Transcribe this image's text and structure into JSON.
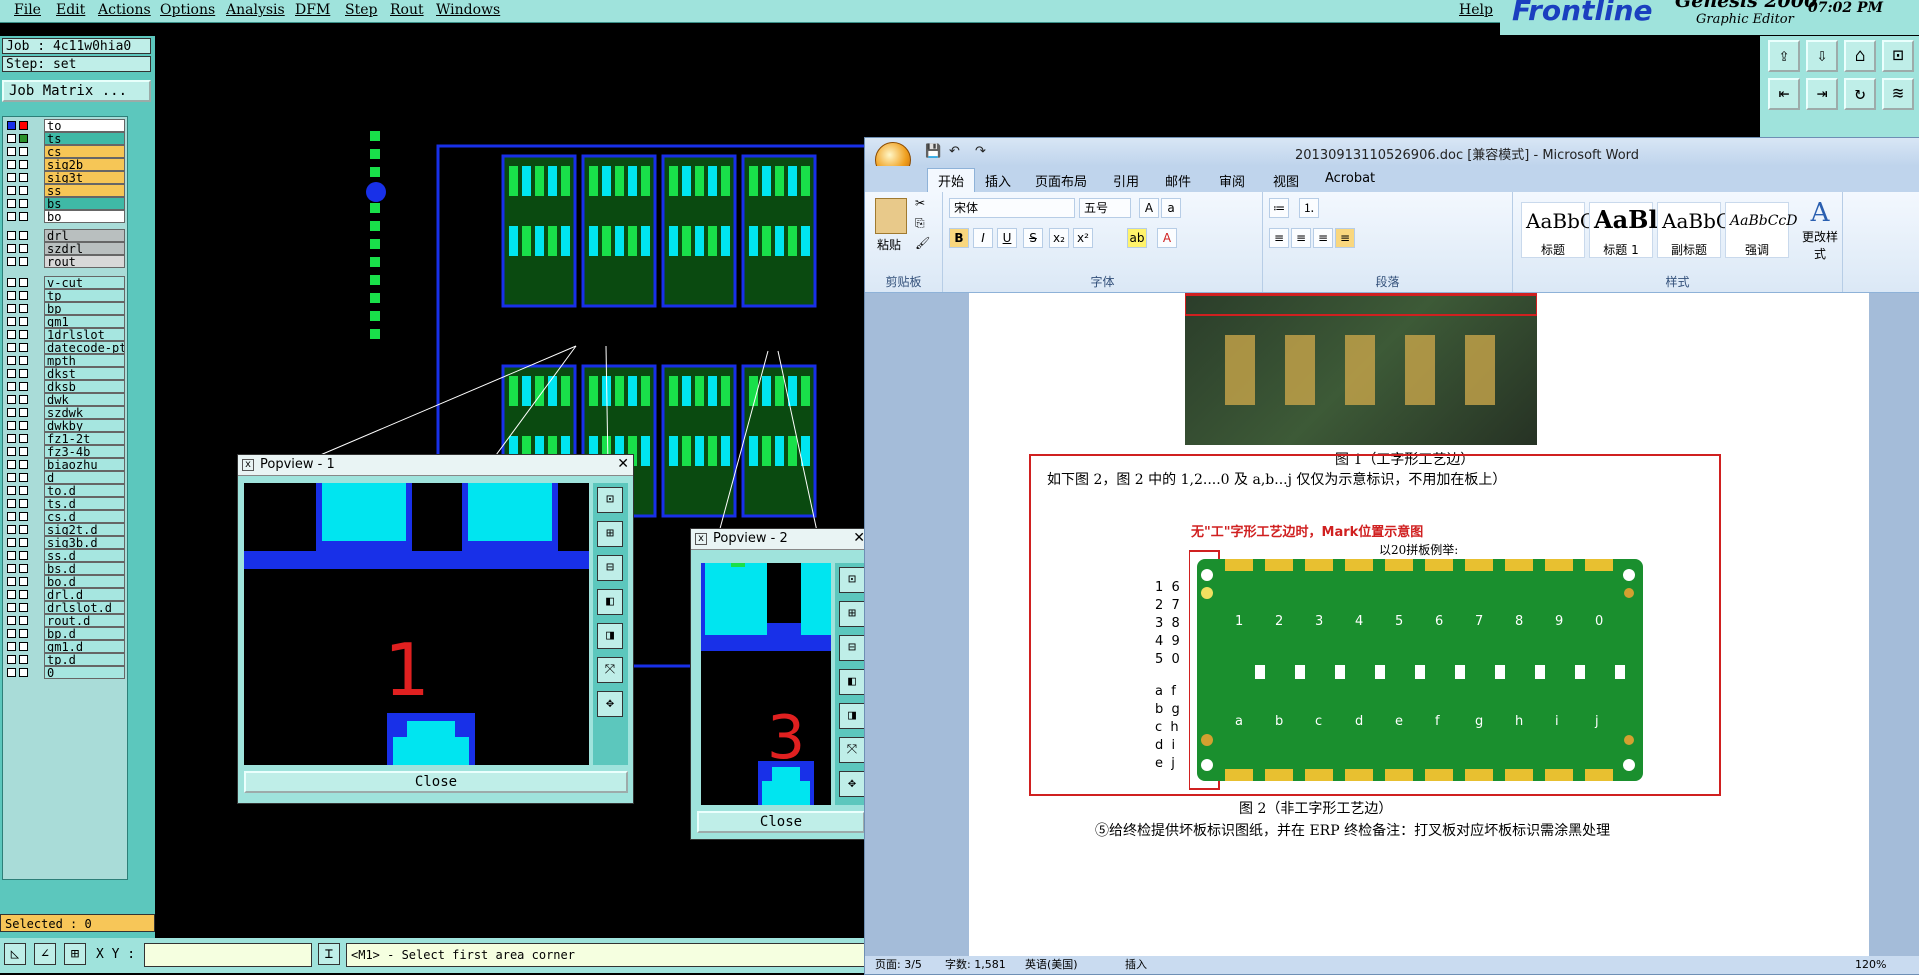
{
  "menubar": {
    "items": [
      "File",
      "Edit",
      "Actions",
      "Options",
      "Analysis",
      "DFM",
      "Step",
      "Rout",
      "Windows"
    ],
    "help": "Help"
  },
  "logo": {
    "brand": "Frontline",
    "product": "Genesis 2000",
    "subtitle": "Graphic Editor",
    "clock": "07:02 PM"
  },
  "left_panel": {
    "job": "Job : 4c11w0hia0",
    "step": "Step: set",
    "job_matrix": "Job Matrix ...",
    "selected": "Selected : 0",
    "layers": [
      {
        "name": "to",
        "color": "#ffffff",
        "dot": "#ff0000"
      },
      {
        "name": "ts",
        "color": "#3fb9a6",
        "dot": "#2a8f2a"
      },
      {
        "name": "cs",
        "color": "#f6c656",
        "dot": "#ffffff"
      },
      {
        "name": "sig2b",
        "color": "#f6c656",
        "dot": "#ffffff"
      },
      {
        "name": "sig3t",
        "color": "#f6c656",
        "dot": "#ffffff"
      },
      {
        "name": "ss",
        "color": "#f6c656",
        "dot": "#ffffff"
      },
      {
        "name": "bs",
        "color": "#3fb9a6",
        "dot": "#ffffff"
      },
      {
        "name": "bo",
        "color": "#ffffff",
        "dot": "#ffffff"
      },
      {
        "name": "drl",
        "color": "#b9bfbf",
        "dot": "#ffffff"
      },
      {
        "name": "szdrl",
        "color": "#b9bfbf",
        "dot": "#ffffff"
      },
      {
        "name": "rout",
        "color": "#d8d8d8",
        "dot": "#ffffff"
      },
      {
        "name": "v-cut",
        "color": "#a6e6e0",
        "dot": "#ffffff"
      },
      {
        "name": "tp",
        "color": "#a6e6e0",
        "dot": "#ffffff"
      },
      {
        "name": "bp",
        "color": "#a6e6e0",
        "dot": "#ffffff"
      },
      {
        "name": "gm1",
        "color": "#a6e6e0",
        "dot": "#ffffff"
      },
      {
        "name": "1drlslot",
        "color": "#a6e6e0",
        "dot": "#ffffff"
      },
      {
        "name": "datecode-pte",
        "color": "#a6e6e0",
        "dot": "#ffffff"
      },
      {
        "name": "mpth",
        "color": "#a6e6e0",
        "dot": "#ffffff"
      },
      {
        "name": "dkst",
        "color": "#a6e6e0",
        "dot": "#ffffff"
      },
      {
        "name": "dksb",
        "color": "#a6e6e0",
        "dot": "#ffffff"
      },
      {
        "name": "dwk",
        "color": "#a6e6e0",
        "dot": "#ffffff"
      },
      {
        "name": "szdwk",
        "color": "#a6e6e0",
        "dot": "#ffffff"
      },
      {
        "name": "dwkby",
        "color": "#a6e6e0",
        "dot": "#ffffff"
      },
      {
        "name": "fz1-2t",
        "color": "#a6e6e0",
        "dot": "#ffffff"
      },
      {
        "name": "fz3-4b",
        "color": "#a6e6e0",
        "dot": "#ffffff"
      },
      {
        "name": "biaozhu",
        "color": "#a6e6e0",
        "dot": "#ffffff"
      },
      {
        "name": "d",
        "color": "#a6e6e0",
        "dot": "#ffffff"
      },
      {
        "name": "to.d",
        "color": "#a6e6e0",
        "dot": "#ffffff"
      },
      {
        "name": "ts.d",
        "color": "#a6e6e0",
        "dot": "#ffffff"
      },
      {
        "name": "cs.d",
        "color": "#a6e6e0",
        "dot": "#ffffff"
      },
      {
        "name": "sig2t.d",
        "color": "#a6e6e0",
        "dot": "#ffffff"
      },
      {
        "name": "sig3b.d",
        "color": "#a6e6e0",
        "dot": "#ffffff"
      },
      {
        "name": "ss.d",
        "color": "#a6e6e0",
        "dot": "#ffffff"
      },
      {
        "name": "bs.d",
        "color": "#a6e6e0",
        "dot": "#ffffff"
      },
      {
        "name": "bo.d",
        "color": "#a6e6e0",
        "dot": "#ffffff"
      },
      {
        "name": "drl.d",
        "color": "#a6e6e0",
        "dot": "#ffffff"
      },
      {
        "name": "drlslot.d",
        "color": "#a6e6e0",
        "dot": "#ffffff"
      },
      {
        "name": "rout.d",
        "color": "#a6e6e0",
        "dot": "#ffffff"
      },
      {
        "name": "bp.d",
        "color": "#a6e6e0",
        "dot": "#ffffff"
      },
      {
        "name": "gm1.d",
        "color": "#a6e6e0",
        "dot": "#ffffff"
      },
      {
        "name": "tp.d",
        "color": "#a6e6e0",
        "dot": "#ffffff"
      },
      {
        "name": "0",
        "color": "#a6e6e0",
        "dot": "#ffffff"
      }
    ]
  },
  "bottom_bar": {
    "xy_label": "X Y :",
    "xy_value": "",
    "message": "<M1> - Select first area corner"
  },
  "popview1": {
    "title": "Popview - 1",
    "marker": "1",
    "close": "Close"
  },
  "popview2": {
    "title": "Popview - 2",
    "marker": "3",
    "close": "Close"
  },
  "word": {
    "title": "20130913110526906.doc [兼容模式] - Microsoft Word",
    "tabs": [
      "开始",
      "插入",
      "页面布局",
      "引用",
      "邮件",
      "审阅",
      "视图",
      "Acrobat"
    ],
    "font_name": "宋体",
    "font_size": "五号",
    "groups": {
      "clipboard": "剪贴板",
      "font": "字体",
      "paragraph": "段落",
      "styles": "样式"
    },
    "paste": "粘贴",
    "styles": [
      {
        "preview": "AaBbC",
        "name": "标题"
      },
      {
        "preview": "AaBl",
        "name": "标题 1"
      },
      {
        "preview": "AaBbC",
        "name": "副标题"
      },
      {
        "preview": "AaBbCcD",
        "name": "强调"
      }
    ],
    "change_styles": "更改样式",
    "doc": {
      "caption1": "图 1（工字形工艺边）",
      "para1": "如下图 2，图 2 中的 1,2....0 及 a,b...j 仅仅为示意标识，不用加在板上）",
      "fig_title": "无\"工\"字形工艺边时，Mark位置示意图",
      "fig_sub": "以20拼板例举:",
      "left_numbers": [
        "1  6",
        "2  7",
        "3  8",
        "4  9",
        "5  0"
      ],
      "left_letters": [
        "a  f",
        "b  g",
        "c  h",
        "d  i",
        "e  j"
      ],
      "top_labels": [
        "1",
        "2",
        "3",
        "4",
        "5",
        "6",
        "7",
        "8",
        "9",
        "0"
      ],
      "bottom_labels": [
        "a",
        "b",
        "c",
        "d",
        "e",
        "f",
        "g",
        "h",
        "i",
        "j"
      ],
      "caption2": "图 2（非工字形工艺边）",
      "para2": "⑤给终检提供坏板标识图纸，并在 ERP 终检备注：打叉板对应坏板标识需涂黑处理"
    },
    "status": {
      "page": "页面: 3/5",
      "words": "字数: 1,581",
      "lang": "英语(美国)",
      "mode": "插入",
      "zoom": "120%"
    }
  },
  "colors": {
    "genesis_bg": "#9fe3dc",
    "layer_panel": "#5cc7bd",
    "pcb_blue": "#1830e8",
    "pcb_cyan": "#00e5f0",
    "pcb_green": "#19e04a",
    "word_ribbon": "#dbe8f6",
    "board_green": "#1a8f2e",
    "mark_red": "#e02020"
  }
}
